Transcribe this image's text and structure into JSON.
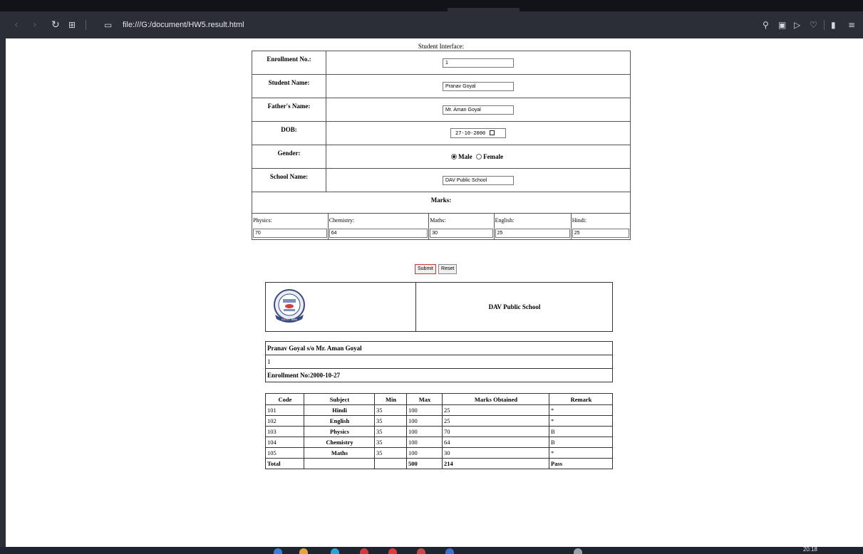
{
  "browser": {
    "url": "file:///G:/document/HW5.result.html",
    "icons": [
      "back-icon",
      "forward-icon",
      "reload-icon",
      "grid-icon",
      "page-icon",
      "search-icon",
      "camera-icon",
      "play-icon",
      "heart-icon",
      "sidebar-icon",
      "menu-icon"
    ]
  },
  "form": {
    "caption": "Student Interface:",
    "enrollment": {
      "label": "Enrollment No.:",
      "value": "1"
    },
    "student_name": {
      "label": "Student Name:",
      "value": "Pranav Goyal"
    },
    "father_name": {
      "label": "Father's Name:",
      "value": "Mr. Aman Goyal"
    },
    "dob": {
      "label": "DOB:",
      "value": "27-10-2000"
    },
    "gender": {
      "label": "Gender:",
      "option_male": "Male",
      "option_female": "Female",
      "selected": "Male"
    },
    "school": {
      "label": "School Name:",
      "value": "DAV Public School"
    },
    "marks_label": "Marks:",
    "subjects": [
      {
        "label": "Physics:",
        "value": "70"
      },
      {
        "label": "Chemistry:",
        "value": "64"
      },
      {
        "label": "Maths:",
        "value": "30"
      },
      {
        "label": "English:",
        "value": "25"
      },
      {
        "label": "Hindi:",
        "value": "25"
      }
    ],
    "submit_label": "Submit",
    "reset_label": "Reset"
  },
  "result": {
    "school_name": "DAV Public School",
    "logo_text": "ESTD. 1886",
    "student_line": "Pranav Goyal s/o Mr. Aman Goyal",
    "enroll_value": "1",
    "enroll_line": "Enrollment No:2000-10-27",
    "headers": [
      "Code",
      "Subject",
      "Min",
      "Max",
      "Marks Obtained",
      "Remark"
    ],
    "rows": [
      {
        "code": "101",
        "subject": "Hindi",
        "min": "35",
        "max": "100",
        "obtained": "25",
        "remark": "*"
      },
      {
        "code": "102",
        "subject": "English",
        "min": "35",
        "max": "100",
        "obtained": "25",
        "remark": "*"
      },
      {
        "code": "103",
        "subject": "Physics",
        "min": "35",
        "max": "100",
        "obtained": "70",
        "remark": "B"
      },
      {
        "code": "104",
        "subject": "Chemistry",
        "min": "35",
        "max": "100",
        "obtained": "64",
        "remark": "B"
      },
      {
        "code": "105",
        "subject": "Maths",
        "min": "35",
        "max": "100",
        "obtained": "30",
        "remark": "*"
      }
    ],
    "total": {
      "label": "Total",
      "max": "500",
      "obtained": "214",
      "remark": "Pass"
    }
  },
  "taskbar": {
    "clock": "20:18"
  },
  "colors": {
    "chrome": "#2b2e36",
    "taskbar": "#1e2530",
    "focus_border": "#c43838"
  }
}
